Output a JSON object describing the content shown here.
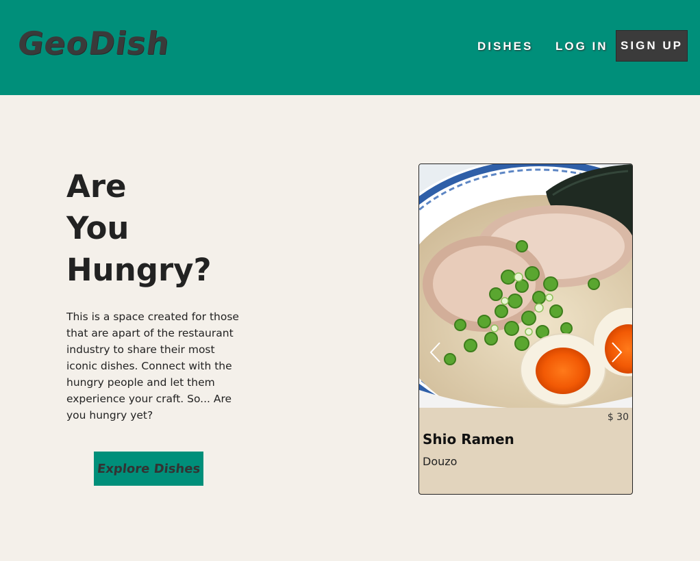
{
  "brand": {
    "logo_text": "GeoDish"
  },
  "nav": {
    "dishes_label": "DISHES",
    "login_label": "LOG IN",
    "signup_label": "SIGN UP"
  },
  "hero": {
    "title_lines": [
      "Are",
      "You",
      "Hungry?"
    ],
    "description": "This is a space created for those that are apart of the restaurant industry to share their most iconic dishes. Connect with the hungry people and let them experience your craft. So... Are you hungry yet?",
    "cta_label": "Explore Dishes"
  },
  "featured_dish": {
    "price": "$ 30",
    "name": "Shio Ramen",
    "restaurant": "Douzo",
    "image_icon": "ramen-bowl-photo"
  },
  "colors": {
    "header_bg": "#008f7a",
    "page_bg": "#f4f0ea",
    "card_bg": "#e2d4bd",
    "signup_bg": "#3b3b3b"
  }
}
